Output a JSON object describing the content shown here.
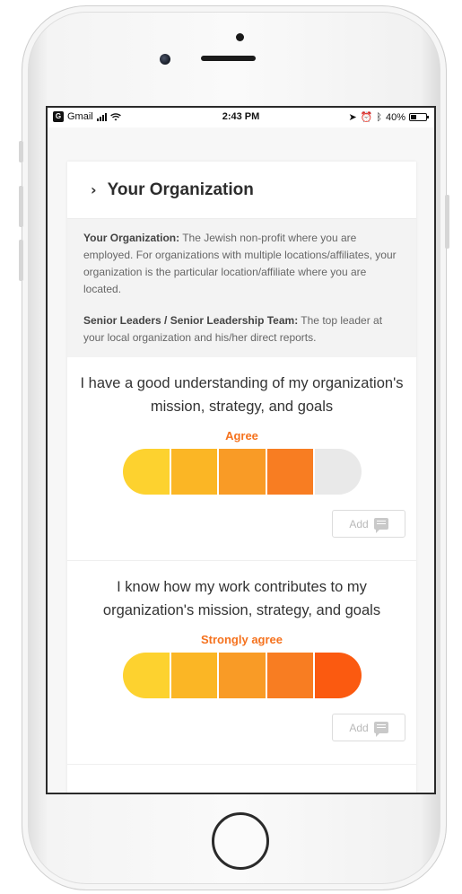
{
  "statusbar": {
    "app": "Gmail",
    "time": "2:43 PM",
    "battery": "40%",
    "battery_level": 0.4
  },
  "card": {
    "title": "Your Organization",
    "definitions": [
      {
        "term": "Your Organization:",
        "text": " The Jewish non-profit where you are employed. For organizations with multiple locations/affiliates, your organization is the particular location/affiliate where you are located."
      },
      {
        "term": "Senior Leaders / Senior Leadership Team:",
        "text": " The top leader at your local organization and his/her direct reports."
      }
    ]
  },
  "questions": [
    {
      "text": "I have a good understanding of my organization's mission, strategy, and goals",
      "answer": "Agree",
      "selected_level": 4,
      "add_label": "Add"
    },
    {
      "text": "I know how my work contributes to my organization's mission, strategy, and goals",
      "answer": "Strongly agree",
      "selected_level": 5,
      "add_label": "Add"
    }
  ],
  "colors": {
    "scale": [
      "#fdd22f",
      "#fbb625",
      "#f99b26",
      "#f87d22",
      "#fb5a10"
    ],
    "unselected": "#e9e9e9",
    "answer_text": "#f5721e"
  }
}
